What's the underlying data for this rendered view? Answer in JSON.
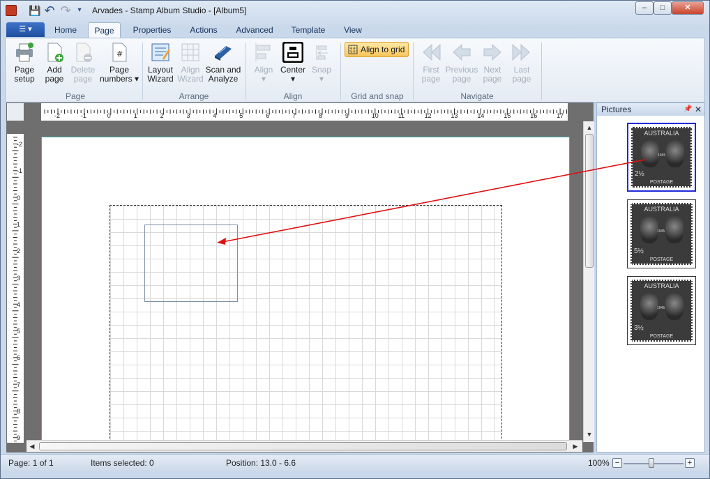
{
  "window": {
    "title": "Arvades - Stamp Album Studio - [Album5]",
    "controls": {
      "minimize": "–",
      "maximize": "□",
      "close": "✕"
    }
  },
  "quick_access": [
    {
      "name": "save-icon",
      "glyph": "💾"
    },
    {
      "name": "undo-icon",
      "glyph": "↶"
    },
    {
      "name": "redo-icon",
      "glyph": "↷"
    },
    {
      "name": "customize-icon",
      "glyph": "▾"
    }
  ],
  "file_menu": {
    "glyph": "☰ ▾"
  },
  "tabs": [
    "Home",
    "Page",
    "Properties",
    "Actions",
    "Advanced",
    "Template",
    "View"
  ],
  "active_tab": "Page",
  "ribbon": {
    "groups": {
      "page": "Page",
      "arrange": "Arrange",
      "align": "Align",
      "grid": "Grid and snap",
      "navigate": "Navigate"
    },
    "buttons": {
      "page_setup": "Page\nsetup",
      "add_page": "Add\npage",
      "delete_page": "Delete\npage",
      "page_numbers": "Page\nnumbers ▾",
      "layout_wizard": "Layout\nWizard",
      "align_wizard": "Align\nWizard",
      "scan_analyze": "Scan and\nAnalyze",
      "align": "Align\n▾",
      "center": "Center\n▾",
      "snap": "Snap\n▾",
      "align_to_grid": "Align to grid",
      "first_page": "First\npage",
      "previous_page": "Previous\npage",
      "next_page": "Next\npage",
      "last_page": "Last\npage"
    }
  },
  "ruler": {
    "horizontal": [
      "-2",
      "-1",
      "0",
      "1",
      "2",
      "3",
      "4",
      "5",
      "6",
      "7",
      "8",
      "9",
      "10",
      "11",
      "12",
      "13",
      "14",
      "15",
      "16",
      "17"
    ],
    "vertical": [
      "-2",
      "-1",
      "0",
      "1",
      "2",
      "3",
      "4",
      "5",
      "6",
      "7",
      "8",
      "9"
    ]
  },
  "pictures_pane": {
    "title": "Pictures",
    "pin": "📌",
    "close": "✕",
    "stamps": [
      {
        "country": "AUSTRALIA",
        "value": "2½",
        "caption": "POSTAGE",
        "year": "1945",
        "selected": true
      },
      {
        "country": "AUSTRALIA",
        "value": "5½",
        "caption": "POSTAGE",
        "year": "1945",
        "selected": false
      },
      {
        "country": "AUSTRALIA",
        "value": "3½",
        "caption": "POSTAGE",
        "year": "1945",
        "selected": false
      }
    ]
  },
  "status": {
    "page": "Page: 1 of 1",
    "items_selected": "Items selected: 0",
    "position": "Position: 13.0 - 6.6",
    "zoom": "100%",
    "zoom_out": "−",
    "zoom_in": "+"
  },
  "colors": {
    "drag_arrow": "#e01010",
    "selection": "#1f2bd6",
    "page_border": "#36b5b0"
  }
}
